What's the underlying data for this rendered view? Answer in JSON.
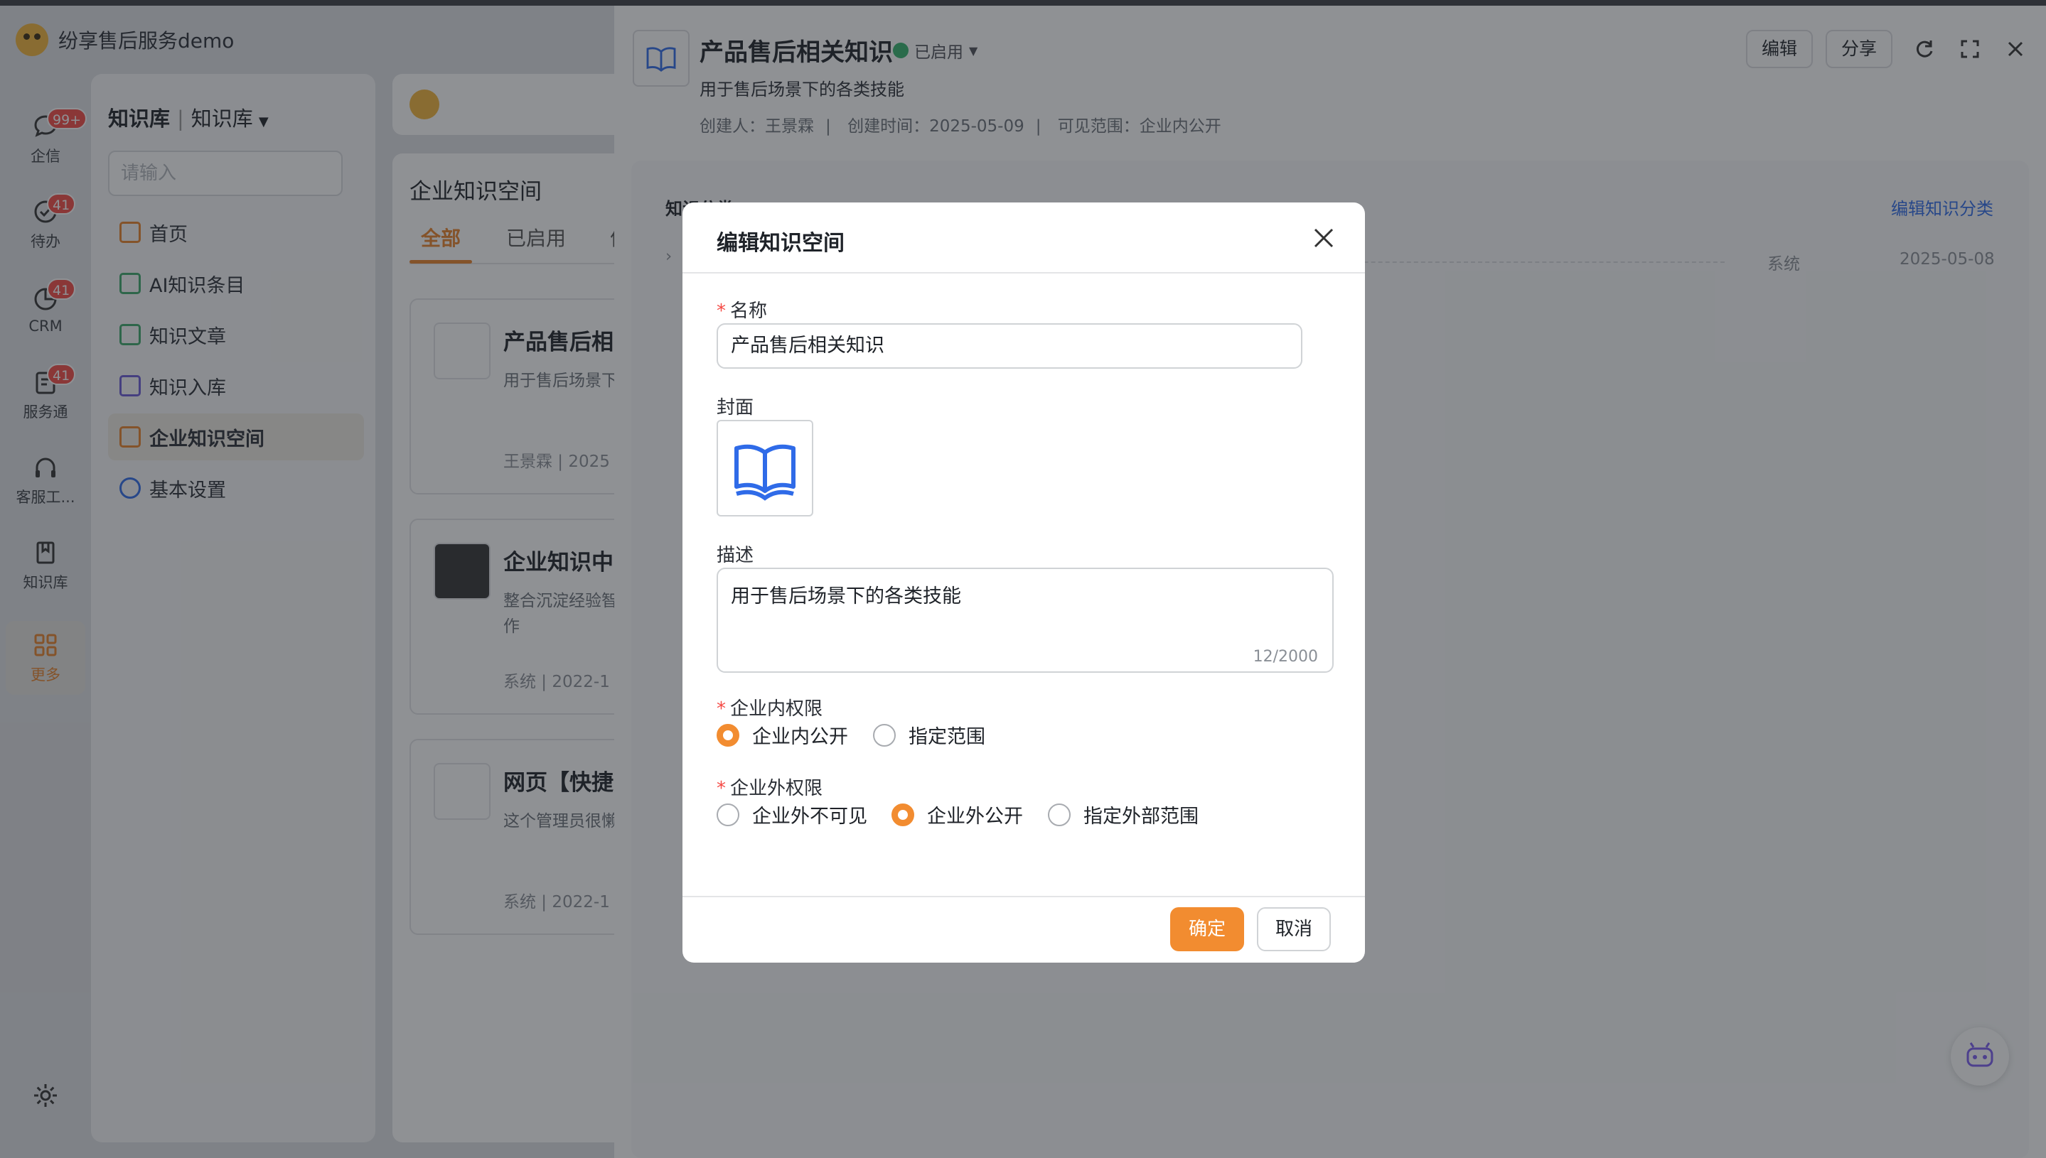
{
  "app": {
    "name": "纷享售后服务demo"
  },
  "rail": {
    "items": [
      {
        "label": "企信",
        "badge": "99+"
      },
      {
        "label": "待办",
        "badge": "41"
      },
      {
        "label": "CRM",
        "badge": "41"
      },
      {
        "label": "服务通",
        "badge": "41"
      },
      {
        "label": "客服工..."
      },
      {
        "label": "知识库"
      },
      {
        "label": "更多"
      }
    ]
  },
  "nav": {
    "title": "知识库",
    "scope": "知识库",
    "search_placeholder": "请输入",
    "items": [
      "首页",
      "AI知识条目",
      "知识文章",
      "知识入库",
      "企业知识空间",
      "基本设置"
    ],
    "collapse": "«"
  },
  "mid": {
    "title": "企业知识空间",
    "tabs": [
      "全部",
      "已启用",
      "停"
    ],
    "cards": [
      {
        "title": "产品售后相",
        "desc": "用于售后场景下",
        "author": "王景霖",
        "date": "2025"
      },
      {
        "title": "企业知识中",
        "desc": "整合沉淀经验智 高效运作",
        "author": "系统",
        "date": "2022-1"
      },
      {
        "title": "网页【快捷",
        "desc": "这个管理员很懒",
        "author": "系统",
        "date": "2022-1"
      }
    ]
  },
  "detail": {
    "title": "产品售后相关知识",
    "status": "已启用",
    "description": "用于售后场景下的各类技能",
    "creator": "创建人：王景霖",
    "created": "创建时间：2025-05-09",
    "visibility": "可见范围：企业内公开",
    "edit_btn": "编辑",
    "share_btn": "分享",
    "panel_title": "知识分类",
    "panel_link": "编辑知识分类",
    "row_source": "系统",
    "row_date": "2025-05-08"
  },
  "modal": {
    "title": "编辑知识空间",
    "name_label": "名称",
    "name_value": "产品售后相关知识",
    "cover_label": "封面",
    "desc_label": "描述",
    "desc_value": "用于售后场景下的各类技能",
    "desc_count": "12/2000",
    "internal_label": "企业内权限",
    "internal_options": [
      "企业内公开",
      "指定范围"
    ],
    "internal_selected": "企业内公开",
    "external_label": "企业外权限",
    "external_options": [
      "企业外不可见",
      "企业外公开",
      "指定外部范围"
    ],
    "external_selected": "企业外公开",
    "ok": "确定",
    "cancel": "取消"
  },
  "colors": {
    "accent": "#f28c30",
    "link": "#2f6be8",
    "badge": "#f54a45",
    "status": "#34b36c"
  }
}
